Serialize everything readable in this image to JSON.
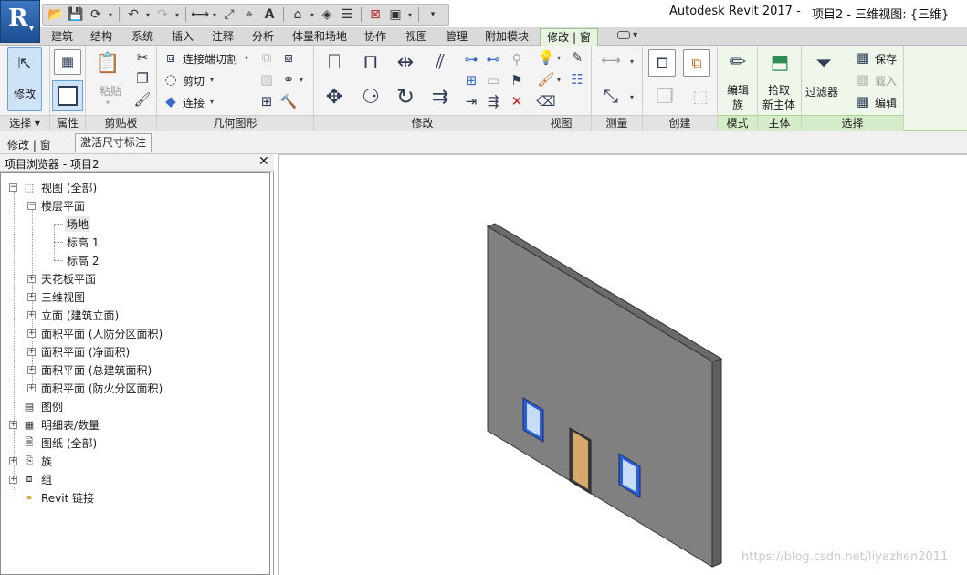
{
  "title_bar": {
    "app_name": "Autodesk Revit 2017 -",
    "document": "项目2 - 三维视图: {三维}"
  },
  "quick_access": [
    {
      "icon": "open-icon"
    },
    {
      "icon": "save-icon"
    },
    {
      "icon": "sync-icon"
    },
    {
      "icon": "undo-icon"
    },
    {
      "icon": "redo-icon"
    },
    {
      "icon": "measure-icon"
    },
    {
      "icon": "aligned-dimension-icon"
    },
    {
      "icon": "tag-icon"
    },
    {
      "icon": "text-icon"
    },
    {
      "icon": "3d-view-icon"
    },
    {
      "icon": "section-icon"
    },
    {
      "icon": "thin-lines-icon"
    },
    {
      "icon": "close-hidden-icon"
    },
    {
      "icon": "switch-windows-icon"
    },
    {
      "icon": "customize-icon"
    }
  ],
  "ribbon_tabs": [
    "建筑",
    "结构",
    "系统",
    "插入",
    "注释",
    "分析",
    "体量和场地",
    "协作",
    "视图",
    "管理",
    "附加模块",
    "修改 | 窗"
  ],
  "active_tab": "修改 | 窗",
  "panels": {
    "select": {
      "label": "选择",
      "modify": "修改"
    },
    "properties": {
      "label": "属性"
    },
    "clipboard": {
      "label": "剪贴板",
      "paste": "粘贴"
    },
    "geometry": {
      "label": "几何图形",
      "join_cut": "连接端切割",
      "cut": "剪切",
      "join": "连接"
    },
    "modify": {
      "label": "修改"
    },
    "view": {
      "label": "视图"
    },
    "measure": {
      "label": "测量"
    },
    "create": {
      "label": "创建"
    },
    "mode": {
      "label": "模式",
      "edit_family_1": "编辑",
      "edit_family_2": "族"
    },
    "host": {
      "label": "主体",
      "pick_host_1": "拾取",
      "pick_host_2": "新主体"
    },
    "filter": {
      "filter": "过滤器"
    },
    "selection": {
      "label": "选择",
      "save": "保存",
      "load": "载入",
      "edit": "编辑"
    }
  },
  "options_bar": {
    "context": "修改 | 窗",
    "activate_dimensions": "激活尺寸标注"
  },
  "project_browser": {
    "title": "项目浏览器 - 项目2",
    "tree": [
      {
        "text": "视图 (全部)",
        "level": 0,
        "toggle": "−",
        "icon": "views-icon"
      },
      {
        "text": "楼层平面",
        "level": 1,
        "toggle": "−",
        "icon": ""
      },
      {
        "text": "场地",
        "level": 2,
        "toggle": "",
        "icon": "",
        "selected": true
      },
      {
        "text": "标高 1",
        "level": 2,
        "toggle": "",
        "icon": ""
      },
      {
        "text": "标高 2",
        "level": 2,
        "toggle": "",
        "icon": ""
      },
      {
        "text": "天花板平面",
        "level": 1,
        "toggle": "+",
        "icon": ""
      },
      {
        "text": "三维视图",
        "level": 1,
        "toggle": "+",
        "icon": ""
      },
      {
        "text": "立面 (建筑立面)",
        "level": 1,
        "toggle": "+",
        "icon": ""
      },
      {
        "text": "面积平面 (人防分区面积)",
        "level": 1,
        "toggle": "+",
        "icon": ""
      },
      {
        "text": "面积平面 (净面积)",
        "level": 1,
        "toggle": "+",
        "icon": ""
      },
      {
        "text": "面积平面 (总建筑面积)",
        "level": 1,
        "toggle": "+",
        "icon": ""
      },
      {
        "text": "面积平面 (防火分区面积)",
        "level": 1,
        "toggle": "+",
        "icon": ""
      },
      {
        "text": "图例",
        "level": 0,
        "toggle": "",
        "icon": "legend-icon"
      },
      {
        "text": "明细表/数量",
        "level": 0,
        "toggle": "+",
        "icon": "schedule-icon"
      },
      {
        "text": "图纸 (全部)",
        "level": 0,
        "toggle": "",
        "icon": "sheet-icon"
      },
      {
        "text": "族",
        "level": 0,
        "toggle": "+",
        "icon": "family-icon"
      },
      {
        "text": "组",
        "level": 0,
        "toggle": "+",
        "icon": "group-icon"
      },
      {
        "text": "Revit 链接",
        "level": 0,
        "toggle": "",
        "icon": "link-icon"
      }
    ]
  },
  "viewport": {
    "wall_color": "#808080",
    "wall_edge_color": "#5a5a5a",
    "window_frame_color": "#2b5fd9",
    "window_glass_color": "#c9dcf7",
    "door_color": "#d7a86e"
  },
  "watermark": "https://blog.csdn.net/liyazhen2011"
}
